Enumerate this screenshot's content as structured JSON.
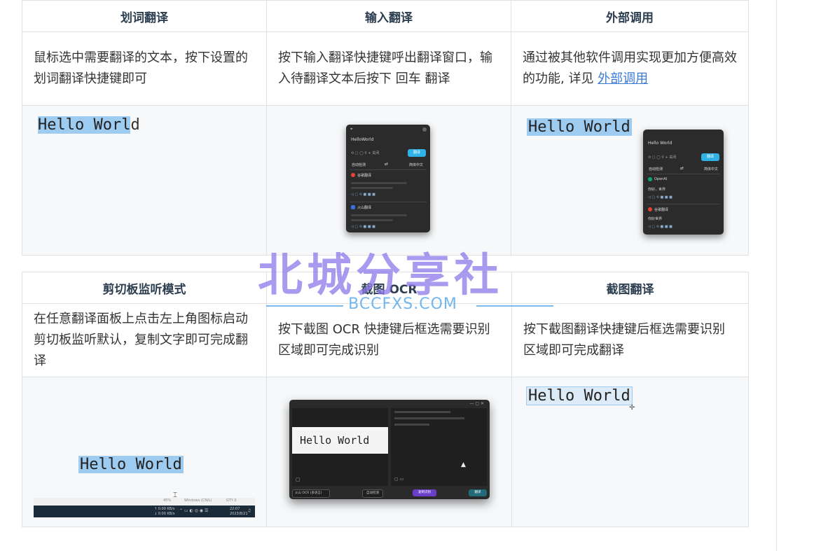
{
  "table1": {
    "headers": [
      "划词翻译",
      "输入翻译",
      "外部调用"
    ],
    "desc_1": "鼠标选中需要翻译的文本，按下设置的划词翻译快捷键即可",
    "desc_2": "按下输入翻译快捷键呼出翻译窗口，输入待翻译文本后按下 回车 翻译",
    "desc_3_text": "通过被其他软件调用实现更加方便高效的功能, 详见 ",
    "desc_3_link": "外部调用"
  },
  "table2": {
    "headers": [
      "剪切板监听模式",
      "截图 OCR",
      "截图翻译"
    ],
    "desc_1": "在任意翻译面板上点击左上角图标启动剪切板监听默认，复制文字即可完成翻译",
    "desc_2": "按下截图 OCR 快捷键后框选需要识别区域即可完成识别",
    "desc_3": "按下截图翻译快捷键后框选需要识别区域即可完成翻译"
  },
  "demo": {
    "hello": "Hello World",
    "hello_sel": "Hello Worl",
    "hello_tail": "d",
    "input_text": "HelloWorld",
    "input_text2": "Hello World",
    "btn_translate": "翻译",
    "lang_auto": "自动检测",
    "lang_target": "简体中文",
    "swap": "⇄",
    "svc_google": "谷歌翻译",
    "svc_other": "火山翻译",
    "svc_openai": "OpenAI",
    "result": "你好，世界",
    "result2": "你好世界",
    "ocr_btn_lang": "火山 OCR (多语言)",
    "ocr_btn_detect": "自动检测",
    "ocr_btn_purple": "复制识别",
    "ocr_btn_tr": "翻译",
    "taskbar_net1": "↑ 0.00 KB/s",
    "taskbar_net2": "↓ 0.00 KB/s",
    "taskbar_time": "22:07",
    "taskbar_date": "2023/8/21",
    "taskbar_cpu": "45%",
    "taskbar_mid": "Windows (CN/L)",
    "taskbar_gpu": "GTY 0"
  },
  "watermark": {
    "title": "北城分享社",
    "site": "BCCFXS.COM"
  },
  "colors": {
    "accent": "#2fb2e6",
    "link": "#3a7bd5",
    "highlight": "#9ecbf0",
    "watermark": "#8c78eb"
  }
}
